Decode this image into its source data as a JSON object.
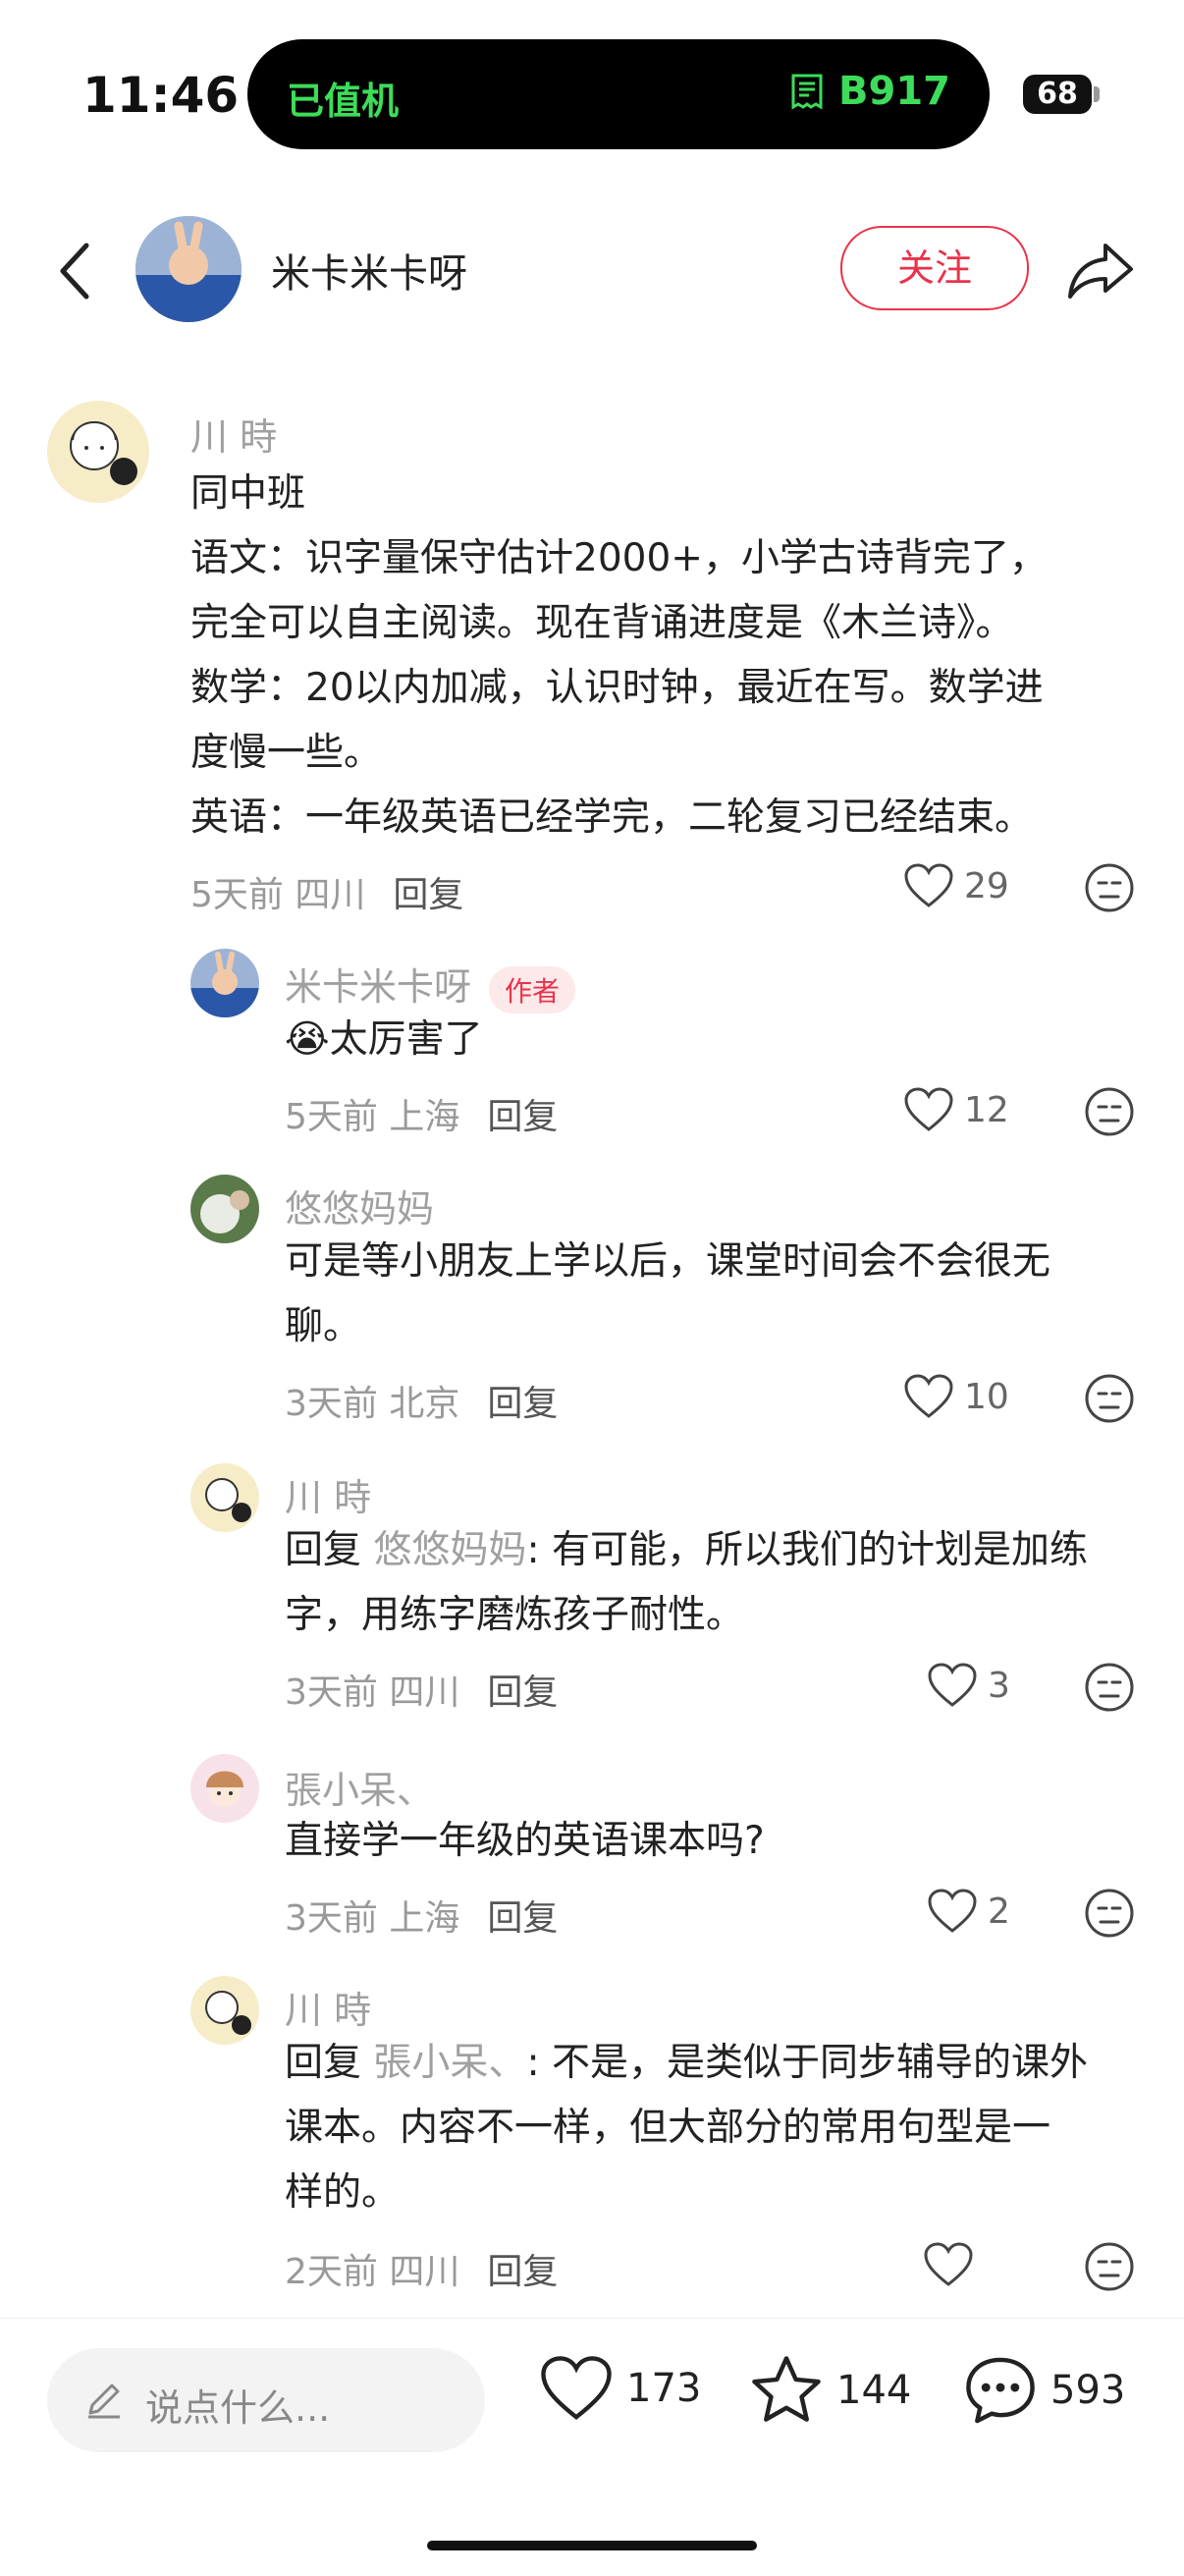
{
  "status_bar": {
    "time": "11:46",
    "island_left": "已值机",
    "island_right": "B917",
    "battery": "68"
  },
  "header": {
    "username": "米卡米卡呀",
    "follow_label": "关注"
  },
  "comments": [
    {
      "name": "川 時",
      "text_lines": [
        "同中班",
        "语文：识字量保守估计2000+，小学古诗背完了，",
        "完全可以自主阅读。现在背诵进度是《木兰诗》。",
        "数学：20以内加减，认识时钟，最近在写。数学进",
        "度慢一些。",
        "英语：一年级英语已经学完，二轮复习已经结束。"
      ],
      "meta": "5天前 四川",
      "reply": "回复",
      "likes": "29"
    },
    {
      "name": "米卡米卡呀",
      "author_tag": "作者",
      "emoji": "😭",
      "text": "太厉害了",
      "meta": "5天前 上海",
      "reply": "回复",
      "likes": "12"
    },
    {
      "name": "悠悠妈妈",
      "text_lines": [
        "可是等小朋友上学以后，课堂时间会不会很无",
        "聊。"
      ],
      "meta": "3天前 北京",
      "reply": "回复",
      "likes": "10"
    },
    {
      "name": "川 時",
      "reply_prefix": "回复",
      "mention": "悠悠妈妈",
      "text_line1": ": 有可能，所以我们的计划是加练",
      "text_line2": "字，用练字磨炼孩子耐性。",
      "meta": "3天前 四川",
      "reply": "回复",
      "likes": "3"
    },
    {
      "name": "張小呆、",
      "text": "直接学一年级的英语课本吗?",
      "meta": "3天前 上海",
      "reply": "回复",
      "likes": "2"
    },
    {
      "name": "川 時",
      "reply_prefix": "回复",
      "mention": "張小呆、",
      "text_line1": ": 不是，是类似于同步辅导的课外",
      "text_line2": "课本。内容不一样，但大部分的常用句型是一",
      "text_line3": "样的。",
      "meta": "2天前 四川",
      "reply": "回复",
      "likes": ""
    }
  ],
  "bottom_bar": {
    "input_placeholder": "说点什么...",
    "likes": "173",
    "stars": "144",
    "comments": "593"
  },
  "colors": {
    "accent": "#e8334a",
    "green": "#3ddc5a"
  },
  "icons": [
    "back-icon",
    "share-icon",
    "heart-icon",
    "dislike-face-icon",
    "pencil-icon",
    "star-icon",
    "comment-bubble-icon",
    "boarding-pass-icon"
  ]
}
